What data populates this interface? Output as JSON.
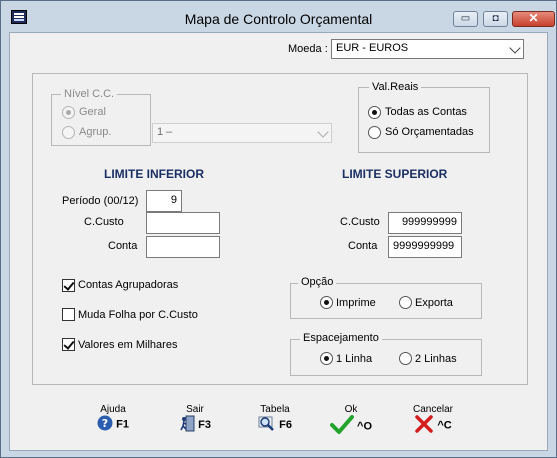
{
  "window": {
    "title": "Mapa de Controlo Orçamental",
    "minimize_glyph": "▭",
    "maximize_glyph": "◘",
    "close_glyph": "✕"
  },
  "moeda": {
    "label": "Moeda :",
    "value": "EUR - EUROS"
  },
  "nivel_cc": {
    "legend": "Nível C.C.",
    "geral": "Geral",
    "agrup": "Agrup.",
    "agrup_select_value": "1  –",
    "selected": "Geral"
  },
  "val_reais": {
    "legend": "Val.Reais",
    "todas": "Todas as Contas",
    "so_orcamentadas": "Só Orçamentadas",
    "selected": "Todas as Contas"
  },
  "limite_inferior": {
    "header": "LIMITE INFERIOR",
    "periodo_label": "Período (00/12)",
    "periodo_value": "9",
    "ccusto_label": "C.Custo",
    "ccusto_value": "",
    "conta_label": "Conta",
    "conta_value": ""
  },
  "limite_superior": {
    "header": "LIMITE SUPERIOR",
    "ccusto_label": "C.Custo",
    "ccusto_value": "999999999",
    "conta_label": "Conta",
    "conta_value": "9999999999"
  },
  "options": {
    "contas_agrupadoras": {
      "label": "Contas Agrupadoras",
      "checked": true
    },
    "muda_folha": {
      "label": "Muda Folha por C.Custo",
      "checked": false
    },
    "valores_milhares": {
      "label": "Valores em Milhares",
      "checked": true
    }
  },
  "opcao": {
    "legend": "Opção",
    "imprime": "Imprime",
    "exporta": "Exporta",
    "selected": "Imprime"
  },
  "espacamento": {
    "legend": "Espacejamento",
    "linha1": "1 Linha",
    "linha2": "2 Linhas",
    "selected": "1 Linha"
  },
  "toolbar": {
    "ajuda": {
      "caption": "Ajuda",
      "key": "F1",
      "icon": "help-icon"
    },
    "sair": {
      "caption": "Sair",
      "key": "F3",
      "icon": "exit-door-icon"
    },
    "tabela": {
      "caption": "Tabela",
      "key": "F6",
      "icon": "magnifier-icon"
    },
    "ok": {
      "caption": "Ok",
      "key": "^O",
      "icon": "checkmark-icon"
    },
    "cancelar": {
      "caption": "Cancelar",
      "key": "^C",
      "icon": "red-x-icon"
    }
  },
  "colors": {
    "title_bg": "#c9d6e4",
    "header_text": "#1b2f63",
    "ok_green": "#22a32a",
    "cancel_red": "#d21e1e",
    "help_blue": "#2a5db0"
  }
}
